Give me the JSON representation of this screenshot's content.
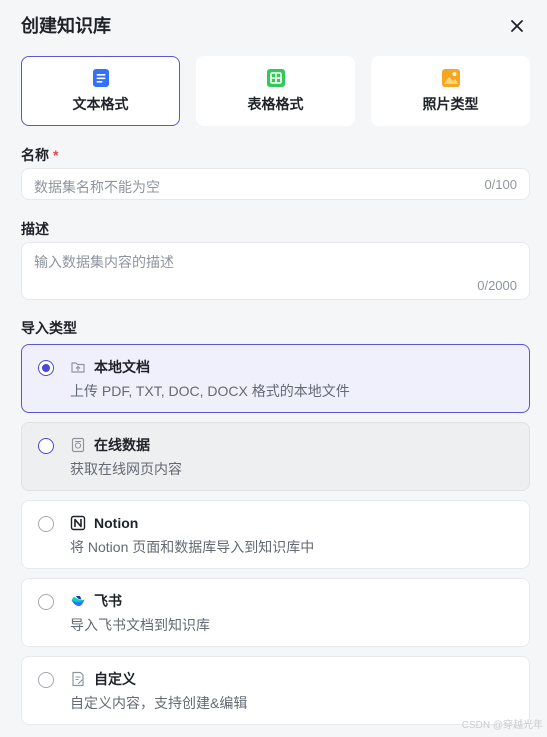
{
  "dialog": {
    "title": "创建知识库"
  },
  "format_tabs": [
    {
      "label": "文本格式",
      "icon": "text-doc-icon",
      "color": "#3370ff",
      "selected": true
    },
    {
      "label": "表格格式",
      "icon": "table-icon",
      "color": "#34c759",
      "selected": false
    },
    {
      "label": "照片类型",
      "icon": "image-icon",
      "color": "#f5a623",
      "selected": false
    }
  ],
  "name_field": {
    "label": "名称",
    "required_mark": "*",
    "placeholder": "数据集名称不能为空",
    "counter": "0/100"
  },
  "desc_field": {
    "label": "描述",
    "placeholder": "输入数据集内容的描述",
    "counter": "0/2000"
  },
  "import": {
    "label": "导入类型",
    "options": [
      {
        "title": "本地文档",
        "desc": "上传 PDF, TXT, DOC, DOCX 格式的本地文件",
        "icon": "upload-folder-icon",
        "selected": true
      },
      {
        "title": "在线数据",
        "desc": "获取在线网页内容",
        "icon": "web-doc-icon",
        "selected": false
      },
      {
        "title": "Notion",
        "desc": "将 Notion 页面和数据库导入到知识库中",
        "icon": "notion-icon",
        "selected": false
      },
      {
        "title": "飞书",
        "desc": "导入飞书文档到知识库",
        "icon": "feishu-icon",
        "selected": false
      },
      {
        "title": "自定义",
        "desc": "自定义内容，支持创建&编辑",
        "icon": "custom-doc-icon",
        "selected": false
      }
    ]
  },
  "watermark": "CSDN @穿越光年",
  "colors": {
    "accent": "#5b56d6",
    "required": "#e5484d"
  }
}
